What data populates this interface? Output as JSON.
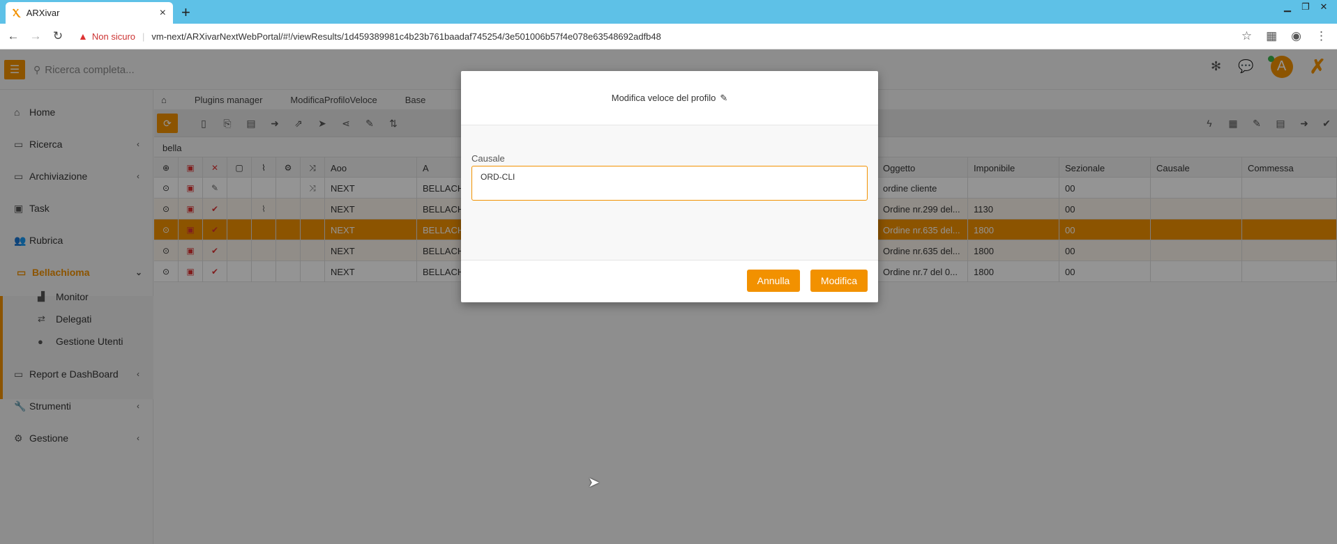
{
  "browser": {
    "tab_title": "ARXivar",
    "tab_close": "×",
    "new_tab": "+",
    "security_label": "Non sicuro",
    "url": "vm-next/ARXivarNextWebPortal/#!/viewResults/1d459389981c4b23b761baadaf745254/3e501006b57f4e078e63548692adfb48"
  },
  "header": {
    "search_placeholder": "Ricerca completa...",
    "avatar_letter": "A"
  },
  "sidebar": {
    "items": [
      {
        "label": "Home"
      },
      {
        "label": "Ricerca"
      },
      {
        "label": "Archiviazione"
      },
      {
        "label": "Task"
      },
      {
        "label": "Rubrica"
      },
      {
        "label": "Bellachioma"
      },
      {
        "label": "Report e DashBoard"
      },
      {
        "label": "Strumenti"
      },
      {
        "label": "Gestione"
      }
    ],
    "sub_items": [
      {
        "label": "Monitor"
      },
      {
        "label": "Delegati"
      },
      {
        "label": "Gestione Utenti"
      }
    ]
  },
  "main": {
    "breadcrumbs": [
      "Plugins manager",
      "ModificaProfiloVeloce",
      "Base"
    ],
    "filter_text": "bella",
    "columns": [
      "Aoo",
      "A",
      "Oggetto",
      "Imponibile",
      "Sezionale",
      "Causale",
      "Commessa"
    ],
    "rows": [
      {
        "aoo": "NEXT",
        "a": "BELLACH",
        "oggetto": "ordine cliente",
        "imponibile": "",
        "sezionale": "00"
      },
      {
        "aoo": "NEXT",
        "a": "BELLACH",
        "oggetto": "Ordine nr.299 del...",
        "imponibile": "1130",
        "sezionale": "00"
      },
      {
        "aoo": "NEXT",
        "a": "BELLACH",
        "oggetto": "Ordine nr.635 del...",
        "imponibile": "1800",
        "sezionale": "00"
      },
      {
        "aoo": "NEXT",
        "a": "BELLACH",
        "oggetto": "Ordine nr.635 del...",
        "imponibile": "1800",
        "sezionale": "00"
      },
      {
        "aoo": "NEXT",
        "a": "BELLACH",
        "oggetto": "Ordine nr.7 del 0...",
        "imponibile": "1800",
        "sezionale": "00"
      }
    ]
  },
  "modal": {
    "title": "Modifica veloce del profilo",
    "field_label": "Causale",
    "field_value": "ORD-CLI",
    "cancel_label": "Annulla",
    "confirm_label": "Modifica"
  }
}
